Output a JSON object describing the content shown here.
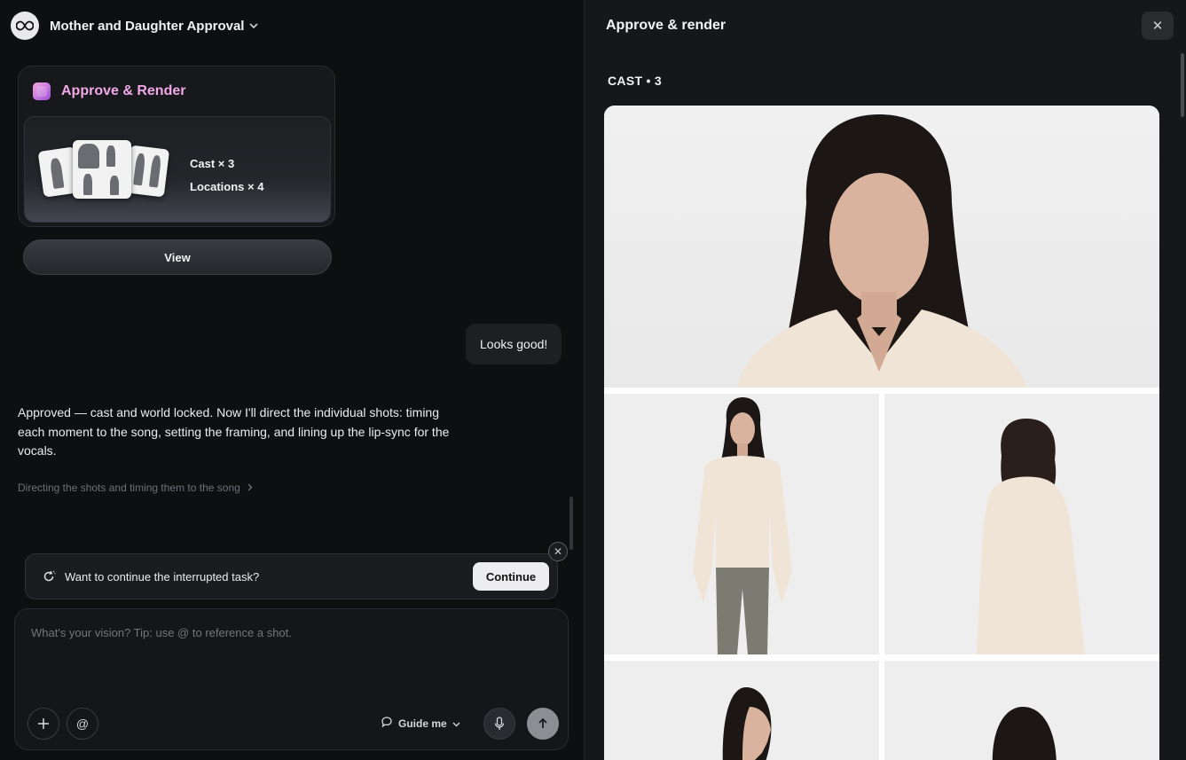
{
  "header": {
    "project_title": "Mother and Daughter Approval"
  },
  "card": {
    "title": "Approve & Render",
    "cast_count": "Cast × 3",
    "locations_count": "Locations × 4",
    "view_label": "View"
  },
  "chat": {
    "user_message": "Looks good!",
    "assistant_message": "Approved — cast and world locked. Now I'll direct the individual shots: timing each moment to the song, setting the framing, and lining up the lip-sync for the vocals.",
    "status_text": "Directing the shots and timing them to the song",
    "resume_prompt": "Want to continue the interrupted task?",
    "continue_label": "Continue"
  },
  "composer": {
    "placeholder": "What's your vision? Tip: use @ to reference a shot.",
    "guide_label": "Guide me"
  },
  "panel": {
    "title": "Approve & render",
    "section_label": "CAST • 3"
  },
  "icons": {
    "logo": "infinity-icon",
    "close": "close-icon",
    "send": "arrow-up-icon",
    "mic": "microphone-icon"
  }
}
